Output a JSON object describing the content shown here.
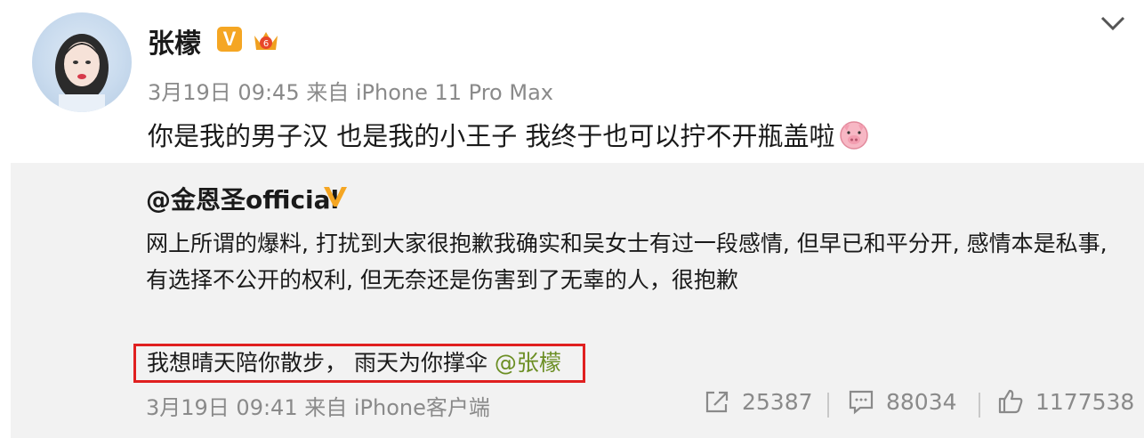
{
  "post": {
    "username": "张檬",
    "verified_label": "V",
    "meta": "3月19日 09:45 来自 iPhone 11 Pro Max",
    "text": "你是我的男子汉  也是我的小王子  我终于也可以拧不开瓶盖啦"
  },
  "repost": {
    "author": "@金恩圣official",
    "body": "网上所谓的爆料, 打扰到大家很抱歉我确实和吴女士有过一段感情, 但早已和平分开, 感情本是私事, 有选择不公开的权利, 但无奈还是伤害到了无辜的人，很抱歉",
    "comment_text": "我想晴天陪你散步，  雨天为你撑伞 ",
    "comment_mention": "@张檬",
    "meta": "3月19日 09:41 来自 iPhone客户端",
    "share_count": "25387",
    "comment_count": "88034",
    "like_count": "1177538"
  },
  "colors": {
    "accent_red": "#e02020",
    "verified_orange": "#f5a623",
    "mention_green": "#6b8e23",
    "meta_gray": "#8a8a8a"
  },
  "icons": [
    "avatar",
    "verified-v-icon",
    "crown-icon",
    "chevron-down-icon",
    "pig-emoji-icon",
    "share-icon",
    "comment-icon",
    "like-icon"
  ]
}
